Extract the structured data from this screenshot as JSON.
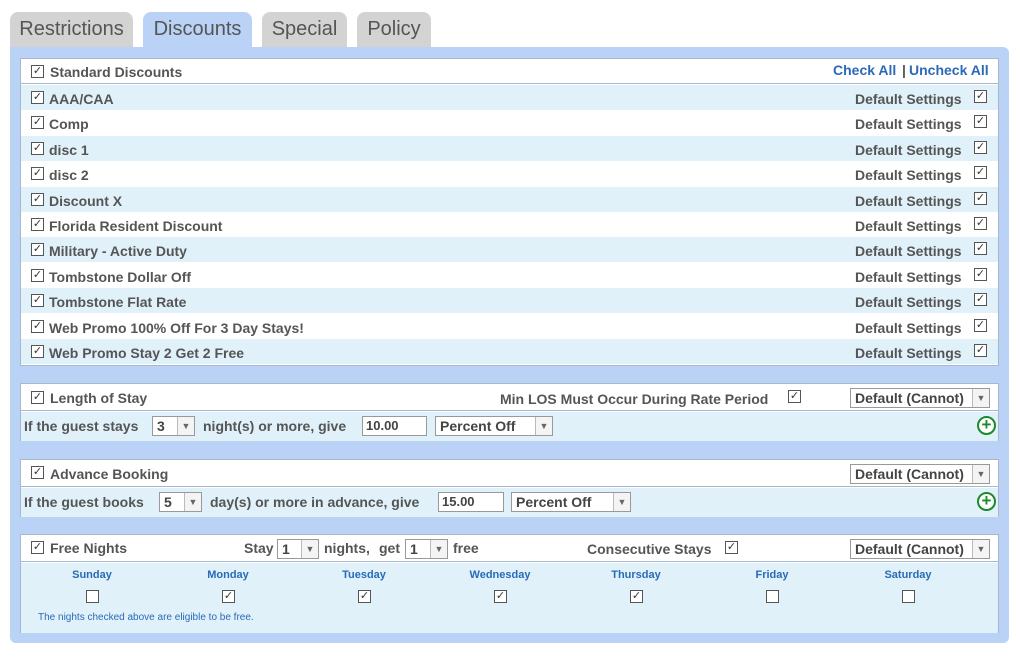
{
  "tabs": [
    {
      "label": "Restrictions",
      "active": false
    },
    {
      "label": "Discounts",
      "active": true
    },
    {
      "label": "Special",
      "active": false
    },
    {
      "label": "Policy",
      "active": false
    }
  ],
  "standard_discounts": {
    "title": "Standard Discounts",
    "checked": true,
    "check_all": "Check All",
    "separator": "|",
    "uncheck_all": "Uncheck All",
    "settings_label": "Default Settings",
    "items": [
      {
        "label": "AAA/CAA",
        "checked": true,
        "settings_checked": true
      },
      {
        "label": "Comp",
        "checked": true,
        "settings_checked": true
      },
      {
        "label": "disc 1",
        "checked": true,
        "settings_checked": true
      },
      {
        "label": "disc 2",
        "checked": true,
        "settings_checked": true
      },
      {
        "label": "Discount X",
        "checked": true,
        "settings_checked": true
      },
      {
        "label": "Florida Resident Discount",
        "checked": true,
        "settings_checked": true
      },
      {
        "label": "Military - Active Duty",
        "checked": true,
        "settings_checked": true
      },
      {
        "label": "Tombstone Dollar Off",
        "checked": true,
        "settings_checked": true
      },
      {
        "label": "Tombstone Flat Rate",
        "checked": true,
        "settings_checked": true
      },
      {
        "label": "Web Promo 100% Off For 3 Day Stays!",
        "checked": true,
        "settings_checked": true
      },
      {
        "label": "Web Promo Stay 2 Get 2 Free",
        "checked": true,
        "settings_checked": true
      }
    ]
  },
  "length_of_stay": {
    "title": "Length of Stay",
    "checked": true,
    "min_los_label": "Min LOS Must Occur During Rate Period",
    "min_los_checked": true,
    "policy_select": "Default (Cannot)",
    "prefix": "If the guest stays",
    "nights_value": "3",
    "middle": "night(s) or more, give",
    "amount": "10.00",
    "type_select": "Percent Off"
  },
  "advance_booking": {
    "title": "Advance Booking",
    "checked": true,
    "policy_select": "Default (Cannot)",
    "prefix": "If the guest books",
    "days_value": "5",
    "middle": "day(s) or more in advance, give",
    "amount": "15.00",
    "type_select": "Percent Off"
  },
  "free_nights": {
    "title": "Free Nights",
    "checked": true,
    "stay_label": "Stay",
    "stay_value": "1",
    "nights_label": "nights,",
    "get_label": "get",
    "get_value": "1",
    "free_label": "free",
    "consecutive_label": "Consecutive Stays",
    "consecutive_checked": true,
    "policy_select": "Default (Cannot)",
    "days": [
      {
        "label": "Sunday",
        "checked": false
      },
      {
        "label": "Monday",
        "checked": true
      },
      {
        "label": "Tuesday",
        "checked": true
      },
      {
        "label": "Wednesday",
        "checked": true
      },
      {
        "label": "Thursday",
        "checked": true
      },
      {
        "label": "Friday",
        "checked": false
      },
      {
        "label": "Saturday",
        "checked": false
      }
    ],
    "note": "The nights checked above are eligible to be free."
  },
  "colors": {
    "tab_active": "#b9d2f5",
    "tab_inactive": "#d3d3d3",
    "frame": "#b9d2f5",
    "row_alt": "#e0f1fa",
    "link": "#2a6ab8",
    "add_icon": "#1a8a2a"
  },
  "icons": {
    "check": "☑",
    "dropdown": "chevron-down-icon",
    "add": "plus-circle-icon"
  }
}
